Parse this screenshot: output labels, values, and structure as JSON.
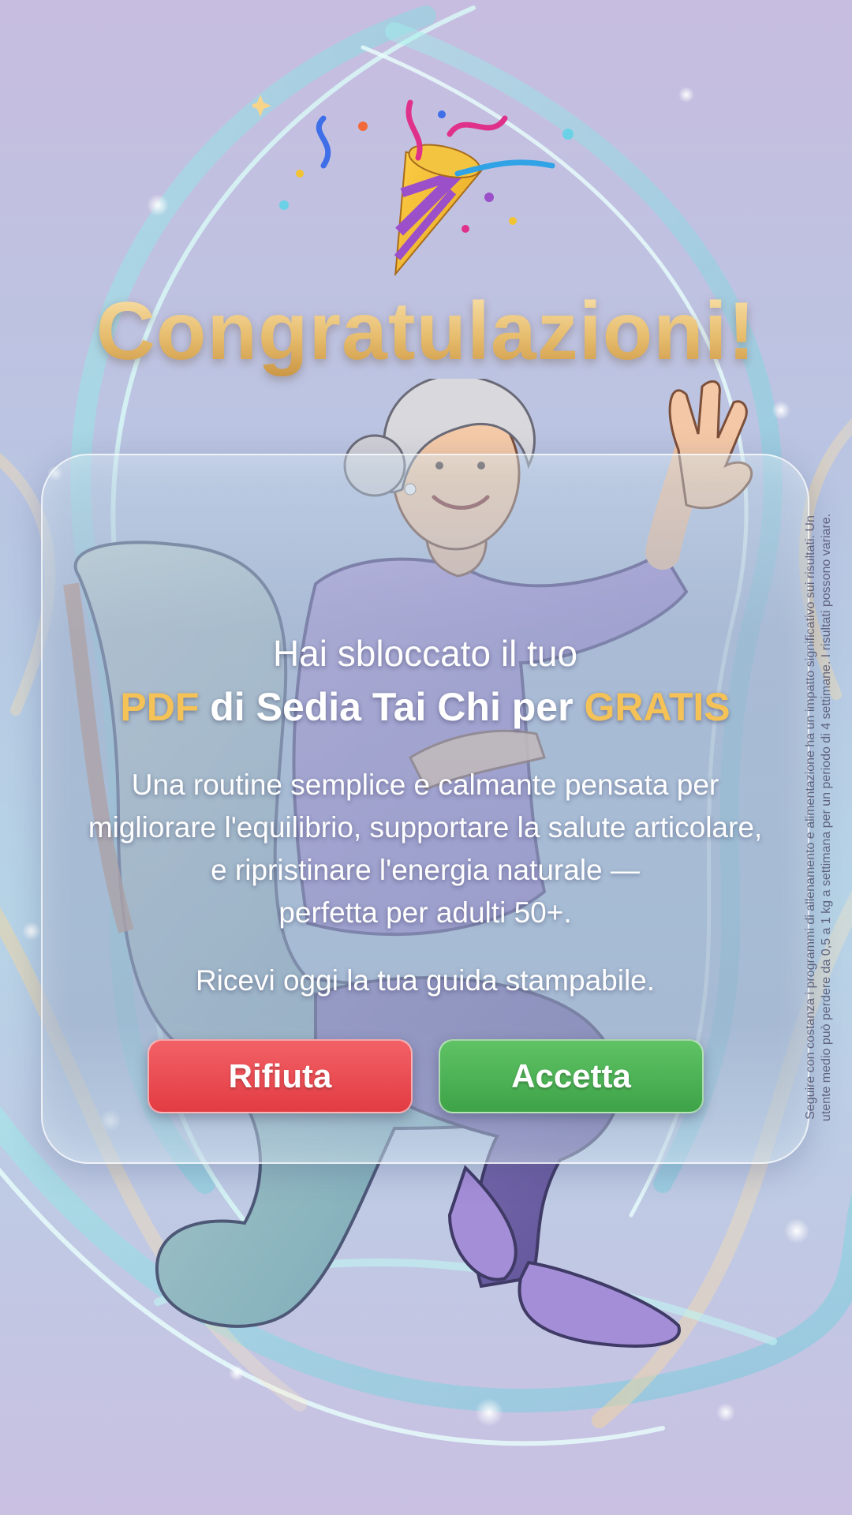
{
  "colors": {
    "headline_gold": "#e7bd6e",
    "highlight_gold": "#f4c256",
    "decline_red": "#e23c43",
    "accept_green": "#3ea348",
    "background_lavender": "#c7bde0",
    "swirl_aqua": "#8fe3e0"
  },
  "decorations": {
    "party_icon": "party-popper-icon",
    "illustration": "senior-woman-chair-tai-chi"
  },
  "headline": "Congratulazioni!",
  "card": {
    "intro": "Hai sbloccato il tuo",
    "offer_highlight_1": "PDF",
    "offer_middle": " di Sedia Tai Chi per ",
    "offer_highlight_2": "GRATIS",
    "description_lines": [
      "Una routine semplice e calmante pensata per",
      "migliorare l'equilibrio, supportare la salute articolare,",
      "e ripristinare l'energia naturale —",
      "perfetta per adulti 50+."
    ],
    "cta_text": "Ricevi oggi la tua guida stampabile."
  },
  "buttons": {
    "decline_label": "Rifiuta",
    "accept_label": "Accetta"
  },
  "disclaimer_lines": [
    "Seguire con costanza i programmi di allenamento e alimentazione ha un impatto significativo sui risultati. Un",
    "utente medio può perdere da 0,5 a 1 kg a settimana per un periodo di 4 settimane. I risultati possono variare."
  ]
}
